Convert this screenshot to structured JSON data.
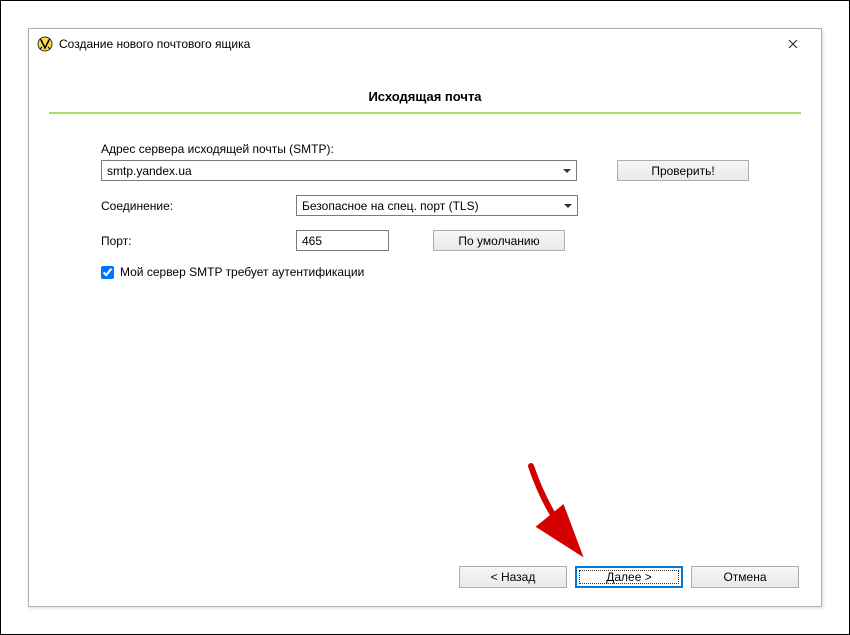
{
  "titlebar": {
    "title": "Создание нового почтового ящика"
  },
  "panel": {
    "heading": "Исходящая почта"
  },
  "form": {
    "server_label": "Адрес сервера исходящей почты (SMTP):",
    "server_value": "smtp.yandex.ua",
    "check_btn": "Проверить!",
    "connection_label": "Соединение:",
    "connection_value": "Безопасное на спец. порт (TLS)",
    "port_label": "Порт:",
    "port_value": "465",
    "default_btn": "По умолчанию",
    "auth_checkbox": "Мой сервер SMTP требует аутентификации",
    "auth_checked": true
  },
  "buttons": {
    "back": "<   Назад",
    "next": "Далее   >",
    "cancel": "Отмена"
  }
}
